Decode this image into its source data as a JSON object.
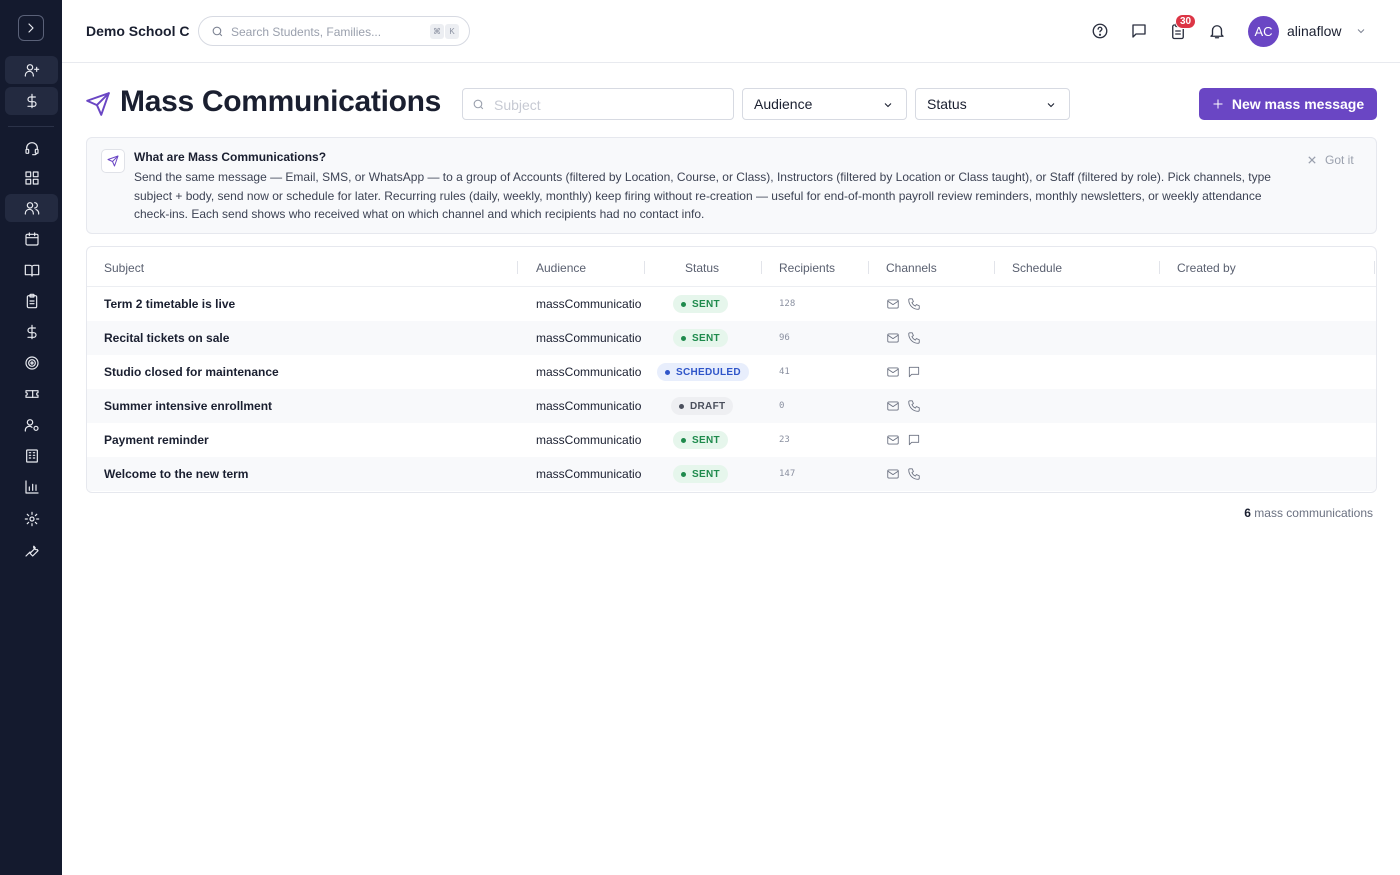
{
  "header": {
    "school": "Demo School C",
    "search_placeholder": "Search Students, Families...",
    "kbd_cmd": "⌘",
    "kbd_key": "K",
    "tasks_badge": "30",
    "avatar_initials": "AC",
    "username": "alinaflow"
  },
  "page": {
    "title": "Mass Communications",
    "subject_placeholder": "Subject",
    "audience_filter": "Audience",
    "status_filter": "Status",
    "new_button": "New mass message"
  },
  "info": {
    "title": "What are Mass Communications?",
    "body": "Send the same message — Email, SMS, or WhatsApp — to a group of Accounts (filtered by Location, Course, or Class), Instructors (filtered by Location or Class taught), or Staff (filtered by role). Pick channels, type subject + body, send now or schedule for later. Recurring rules (daily, weekly, monthly) keep firing without re-creation — useful for end-of-month payroll review reminders, monthly newsletters, or weekly attendance check-ins. Each send shows who received what on which channel and which recipients had no contact info.",
    "dismiss": "Got it"
  },
  "table": {
    "columns": [
      "Subject",
      "Audience",
      "Status",
      "Recipients",
      "Channels",
      "Schedule",
      "Created by"
    ],
    "rows": [
      {
        "subject": "Term 2 timetable is live",
        "audience": "massCommunicatio",
        "status": "SENT",
        "recipients": "128",
        "channels": [
          "mail-icon",
          "phone-icon"
        ]
      },
      {
        "subject": "Recital tickets on sale",
        "audience": "massCommunicatio",
        "status": "SENT",
        "recipients": "96",
        "channels": [
          "mail-icon",
          "phone-icon"
        ]
      },
      {
        "subject": "Studio closed for maintenance",
        "audience": "massCommunicatio",
        "status": "SCHEDULED",
        "recipients": "41",
        "channels": [
          "mail-icon",
          "chat-icon"
        ]
      },
      {
        "subject": "Summer intensive enrollment",
        "audience": "massCommunicatio",
        "status": "DRAFT",
        "recipients": "0",
        "channels": [
          "mail-icon",
          "phone-icon"
        ]
      },
      {
        "subject": "Payment reminder",
        "audience": "massCommunicatio",
        "status": "SENT",
        "recipients": "23",
        "channels": [
          "mail-icon",
          "chat-icon"
        ]
      },
      {
        "subject": "Welcome to the new term",
        "audience": "massCommunicatio",
        "status": "SENT",
        "recipients": "147",
        "channels": [
          "mail-icon",
          "phone-icon"
        ]
      }
    ]
  },
  "footer": {
    "count": "6",
    "count_label": " mass communications"
  },
  "colors": {
    "accent": "#6a46c4",
    "sidebar_bg": "#141a2e",
    "sent_bg": "#e6f6ec",
    "sent_fg": "#1e8a4c",
    "scheduled_bg": "#e8eefc",
    "scheduled_fg": "#2f55c9",
    "draft_bg": "#eeeff2",
    "draft_fg": "#4a4f5c"
  },
  "sidebar": {
    "icons": [
      "user-plus-icon",
      "dollar-icon",
      "headset-icon",
      "dashboard-icon",
      "users-icon",
      "calendar-icon",
      "book-icon",
      "clipboard-icon",
      "dollar-icon",
      "target-icon",
      "ticket-icon",
      "user-gear-icon",
      "building-icon",
      "chart-icon",
      "settings-icon",
      "wrench-icon"
    ]
  }
}
